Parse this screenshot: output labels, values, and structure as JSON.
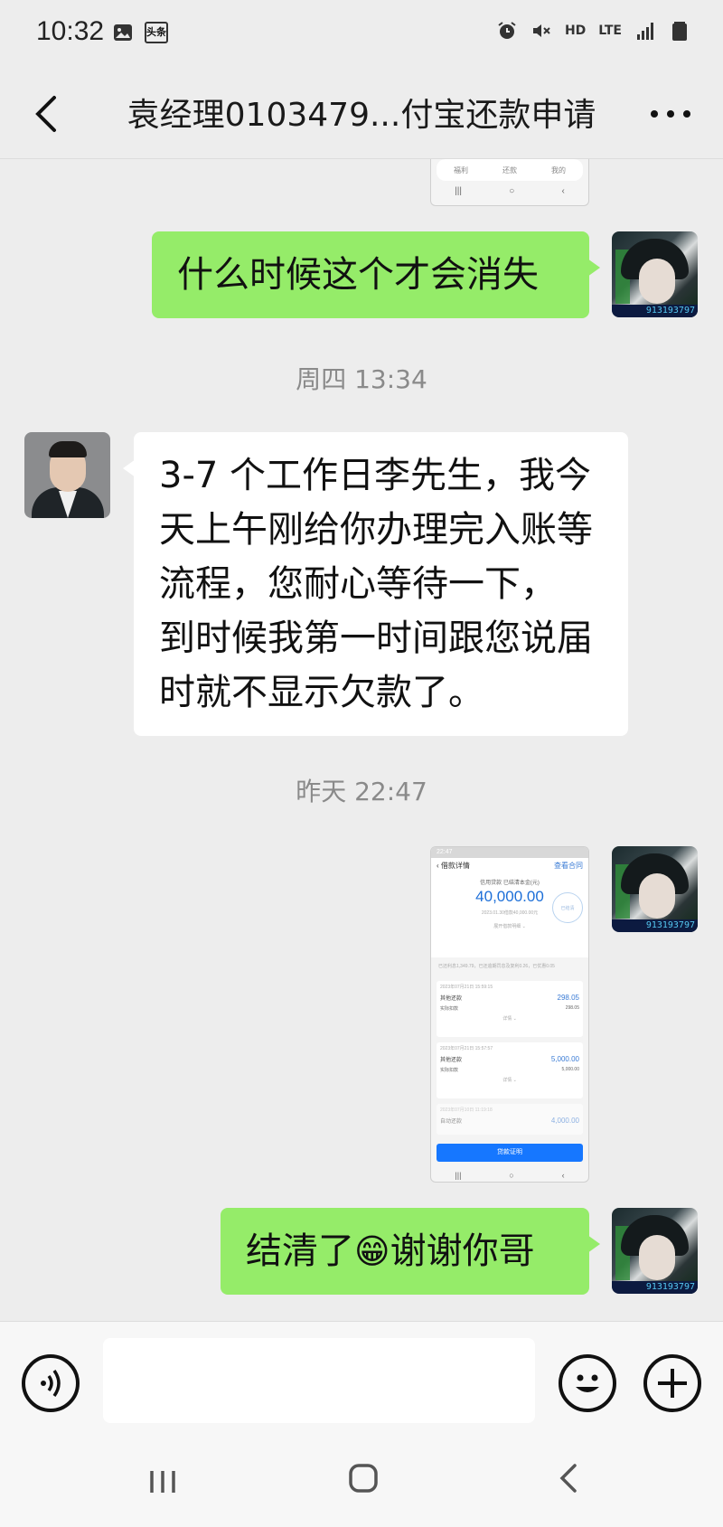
{
  "status_bar": {
    "time": "10:32",
    "left_icons": [
      "gallery-icon",
      "toutiao-icon"
    ],
    "toutiao_label": "头条",
    "right_icons": [
      "alarm-icon",
      "mute-icon",
      "hd-icon",
      "lte-icon",
      "signal-icon",
      "battery-icon"
    ],
    "hd_label": "HD",
    "lte_label": "LTE"
  },
  "header": {
    "title": "袁经理0103479...付宝还款申请",
    "back_icon": "chevron-left-icon",
    "more_icon": "more-icon"
  },
  "thumb_top": {
    "tabs": [
      "福利",
      "还款",
      "我的"
    ],
    "nav": [
      "|||",
      "○",
      "‹"
    ]
  },
  "messages": [
    {
      "side": "self",
      "type": "text",
      "text": "什么时候这个才会消失"
    },
    {
      "type": "time",
      "text": "周四 13:34"
    },
    {
      "side": "other",
      "type": "text",
      "lines": [
        "3-7 个工作日李先生，我今",
        "天上午刚给你办理完入账等",
        "流程，您耐心等待一下，",
        "到时候我第一时间跟您说届",
        "时就不显示欠款了。"
      ]
    },
    {
      "type": "time",
      "text": "昨天 22:47"
    },
    {
      "side": "self",
      "type": "image"
    },
    {
      "side": "self",
      "type": "text",
      "text_before": "结清了",
      "emoji": "😁",
      "text_after": "谢谢你哥"
    }
  ],
  "avatar_tag": "913193797",
  "screenshot": {
    "status_time": "22:47",
    "header_title": "‹ 借款详情",
    "header_link": "查看合同",
    "summary_label": "信用贷款 已结清本金(元)",
    "amount": "40,000.00",
    "date_line": "2023.01.30借款40,000.00元",
    "expand": "展开借款明细 ⌄",
    "stamp": "已结清",
    "note": "已还利息1,349.79，已还逾期罚息及复利0.26，已优惠0.05",
    "records": [
      {
        "date": "2023年07月21日 15:59:15",
        "type": "其他还款",
        "amount": "298.05",
        "actual_label": "实际扣款",
        "actual": "298.05",
        "detail": "详情 ⌄"
      },
      {
        "date": "2023年07月21日 15:57:57",
        "type": "其他还款",
        "amount": "5,000.00",
        "actual_label": "实际扣款",
        "actual": "5,000.00",
        "detail": "详情 ⌄"
      },
      {
        "date": "2023年07月10日 11:19:18",
        "type": "自动还款",
        "amount": "4,000.00"
      }
    ],
    "button": "贷款证明",
    "nav": [
      "|||",
      "○",
      "‹"
    ]
  },
  "input_bar": {
    "voice_icon": "voice-icon",
    "placeholder": "",
    "emoji_icon": "emoji-icon",
    "plus_icon": "plus-icon"
  },
  "nav_bar": {
    "icons": [
      "recent-apps-icon",
      "home-icon",
      "back-icon"
    ]
  },
  "colors": {
    "background": "#ededed",
    "self_bubble": "#95ec69",
    "other_bubble": "#ffffff",
    "timestamp": "#8a8a8a",
    "link_blue": "#1677ff"
  }
}
